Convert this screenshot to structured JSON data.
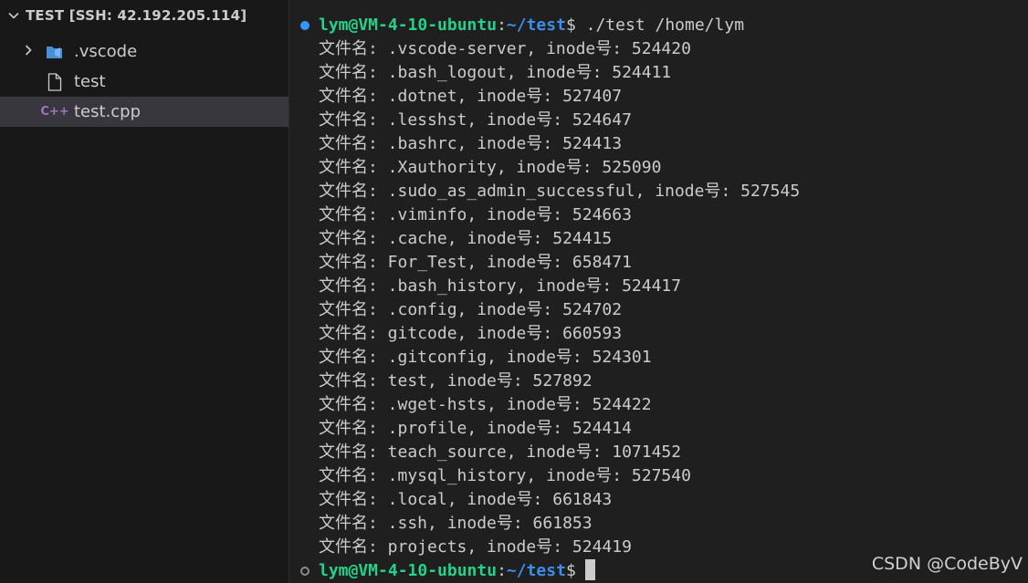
{
  "explorer": {
    "title": "TEST [SSH: 42.192.205.114]",
    "items": [
      {
        "label": ".vscode",
        "icon": "vscode-folder-icon",
        "type": "folder",
        "expanded": false
      },
      {
        "label": "test",
        "icon": "file-icon",
        "type": "file"
      },
      {
        "label": "test.cpp",
        "icon": "cpp-file-icon",
        "type": "file",
        "selected": true,
        "icon_text": "C++"
      }
    ]
  },
  "terminal": {
    "prompt_user": "lym@VM-4-10-ubuntu",
    "prompt_sep": ":",
    "prompt_path": "~/test",
    "prompt_dollar": "$",
    "command": " ./test /home/lym",
    "output": [
      "文件名: .vscode-server, inode号: 524420",
      "文件名: .bash_logout, inode号: 524411",
      "文件名: .dotnet, inode号: 527407",
      "文件名: .lesshst, inode号: 524647",
      "文件名: .bashrc, inode号: 524413",
      "文件名: .Xauthority, inode号: 525090",
      "文件名: .sudo_as_admin_successful, inode号: 527545",
      "文件名: .viminfo, inode号: 524663",
      "文件名: .cache, inode号: 524415",
      "文件名: For_Test, inode号: 658471",
      "文件名: .bash_history, inode号: 524417",
      "文件名: .config, inode号: 524702",
      "文件名: gitcode, inode号: 660593",
      "文件名: .gitconfig, inode号: 524301",
      "文件名: test, inode号: 527892",
      "文件名: .wget-hsts, inode号: 524422",
      "文件名: .profile, inode号: 524414",
      "文件名: teach_source, inode号: 1071452",
      "文件名: .mysql_history, inode号: 527540",
      "文件名: .local, inode号: 661843",
      "文件名: .ssh, inode号: 661853",
      "文件名: projects, inode号: 524419"
    ]
  },
  "watermark": "CSDN @CodeByV",
  "colors": {
    "prompt_user": "#23d18b",
    "prompt_path": "#3b8eea",
    "cpp_icon": "#a074c4",
    "vscode_icon": "#4a8fd6"
  }
}
